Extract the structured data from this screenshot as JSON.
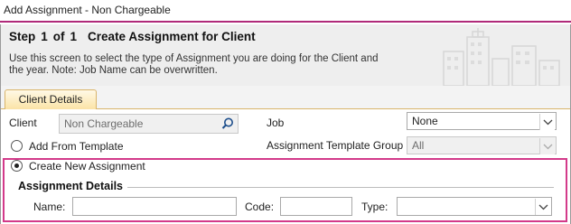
{
  "window": {
    "title": "Add Assignment - Non Chargeable"
  },
  "header": {
    "step_word": "Step",
    "step_current": "1",
    "step_of": "of",
    "step_total": "1",
    "step_title": "Create Assignment for Client",
    "description": "Use this screen to select the type of Assignment you are doing for the Client and the year. Note: Job Name can be overwritten."
  },
  "tabs": [
    {
      "label": "Client Details",
      "active": true
    }
  ],
  "form": {
    "client_label": "Client",
    "client_value": "Non Chargeable",
    "job_label": "Job",
    "job_value": "None",
    "add_from_template_label": "Add From Template",
    "template_group_label": "Assignment Template Group",
    "template_group_value": "All",
    "create_new_label": "Create New Assignment",
    "selected_option": "Create New Assignment"
  },
  "assignment_details": {
    "title": "Assignment Details",
    "name_label": "Name:",
    "name_value": "",
    "code_label": "Code:",
    "code_value": "",
    "type_label": "Type:",
    "type_value": ""
  },
  "colors": {
    "accent": "#d33a8a",
    "title_underline": "#b02a7a",
    "tab_fill": "#fbe3a6",
    "header_bg": "#eeeeee"
  },
  "icons": [
    "search-icon",
    "chevron-down-icon",
    "building-skyline-icon"
  ]
}
